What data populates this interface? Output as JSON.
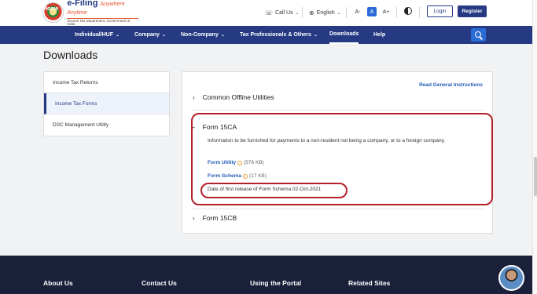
{
  "header": {
    "logo_title": "e-Filing",
    "logo_tagline": "Anywhere Anytime",
    "logo_subtitle": "Income Tax Department, Government of India",
    "call_us": "Call Us",
    "language": "English",
    "font_decrease": "A-",
    "font_normal": "A",
    "font_increase": "A+",
    "login": "Login",
    "register": "Register"
  },
  "nav": {
    "items": [
      {
        "label": "Home"
      },
      {
        "label": "Individual/HUF"
      },
      {
        "label": "Company"
      },
      {
        "label": "Non-Company"
      },
      {
        "label": "Tax Professionals & Others"
      },
      {
        "label": "Downloads"
      },
      {
        "label": "Help"
      }
    ],
    "dropdown_chevron": "⌄",
    "active": "Downloads"
  },
  "page": {
    "title": "Downloads"
  },
  "sidebar": {
    "items": [
      {
        "label": "Income Tax Returns"
      },
      {
        "label": "Income Tax Forms"
      },
      {
        "label": "DSC Management Utility"
      }
    ],
    "active": "Income Tax Forms"
  },
  "main": {
    "instructions_link": "Read General Instructions",
    "sections": {
      "offline": "Common Offline Utilities",
      "form15ca": "Form 15CA",
      "form15cb": "Form 15CB"
    },
    "form15ca": {
      "description": "Information to be furnished for payments to a non-resident not being a company, or to a foreign company.",
      "utility_label": "Form Utility",
      "utility_size": "(576 KB)",
      "schema_label": "Form Schema",
      "schema_size": "(17 KB)",
      "release_label": "Date of first release of Form Schema",
      "release_date": "02-Oct-2021"
    }
  },
  "footer": {
    "headings": [
      "About Us",
      "Contact Us",
      "Using the Portal",
      "Related Sites"
    ]
  },
  "colors": {
    "brand_navy": "#253a83",
    "accent_blue": "#2b6bd6",
    "annotation_red": "#b3202a"
  }
}
